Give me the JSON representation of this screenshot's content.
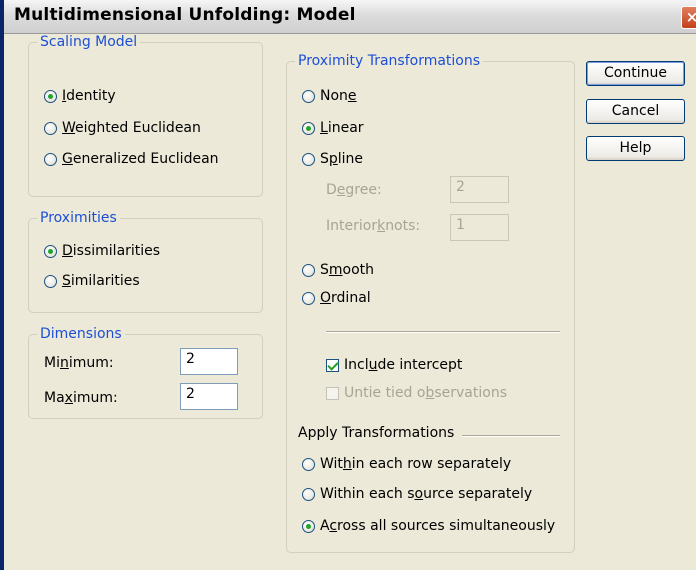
{
  "window": {
    "title": "Multidimensional Unfolding: Model",
    "close_glyph": "×"
  },
  "scaling_model": {
    "legend": "Scaling Model",
    "options": [
      {
        "pre": "",
        "key": "I",
        "post": "dentity",
        "checked": true
      },
      {
        "pre": "",
        "key": "W",
        "post": "eighted Euclidean",
        "checked": false
      },
      {
        "pre": "",
        "key": "G",
        "post": "eneralized Euclidean",
        "checked": false
      }
    ]
  },
  "proximities": {
    "legend": "Proximities",
    "options": [
      {
        "pre": "",
        "key": "D",
        "post": "issimilarities",
        "checked": true
      },
      {
        "pre": "",
        "key": "S",
        "post": "imilarities",
        "checked": false
      }
    ]
  },
  "dimensions": {
    "legend": "Dimensions",
    "minimum": {
      "pre": "Mi",
      "key": "n",
      "post": "imum:",
      "value": "2"
    },
    "maximum": {
      "pre": "Ma",
      "key": "x",
      "post": "imum:",
      "value": "2"
    }
  },
  "proximity_transformations": {
    "legend": "Proximity Transformations",
    "none": {
      "pre": "Non",
      "key": "e",
      "post": "",
      "checked": false
    },
    "linear": {
      "pre": "",
      "key": "L",
      "post": "inear",
      "checked": true
    },
    "spline": {
      "pre": "S",
      "key": "p",
      "post": "line",
      "checked": false
    },
    "degree": {
      "pre": "D",
      "key": "e",
      "post": "gree:",
      "value": "2"
    },
    "interior_knots": {
      "pre": "Interior ",
      "key": "k",
      "post": "nots:",
      "value": "1"
    },
    "smooth": {
      "pre": "S",
      "key": "m",
      "post": "ooth",
      "checked": false
    },
    "ordinal": {
      "pre": "",
      "key": "O",
      "post": "rdinal",
      "checked": false
    },
    "include_intercept": {
      "pre": "Incl",
      "key": "u",
      "post": "de intercept",
      "checked": true
    },
    "untie_tied": {
      "pre": "Untie tied o",
      "key": "b",
      "post": "servations",
      "checked": false
    },
    "apply_label": "Apply Transformations",
    "apply_options": [
      {
        "pre": "Wit",
        "key": "h",
        "post": "in each row separately",
        "checked": false
      },
      {
        "pre": "Within each s",
        "key": "o",
        "post": "urce separately",
        "checked": false
      },
      {
        "pre": "A",
        "key": "c",
        "post": "ross all sources simultaneously",
        "checked": true
      }
    ]
  },
  "buttons": {
    "continue": "Continue",
    "cancel": "Cancel",
    "help": "Help"
  }
}
